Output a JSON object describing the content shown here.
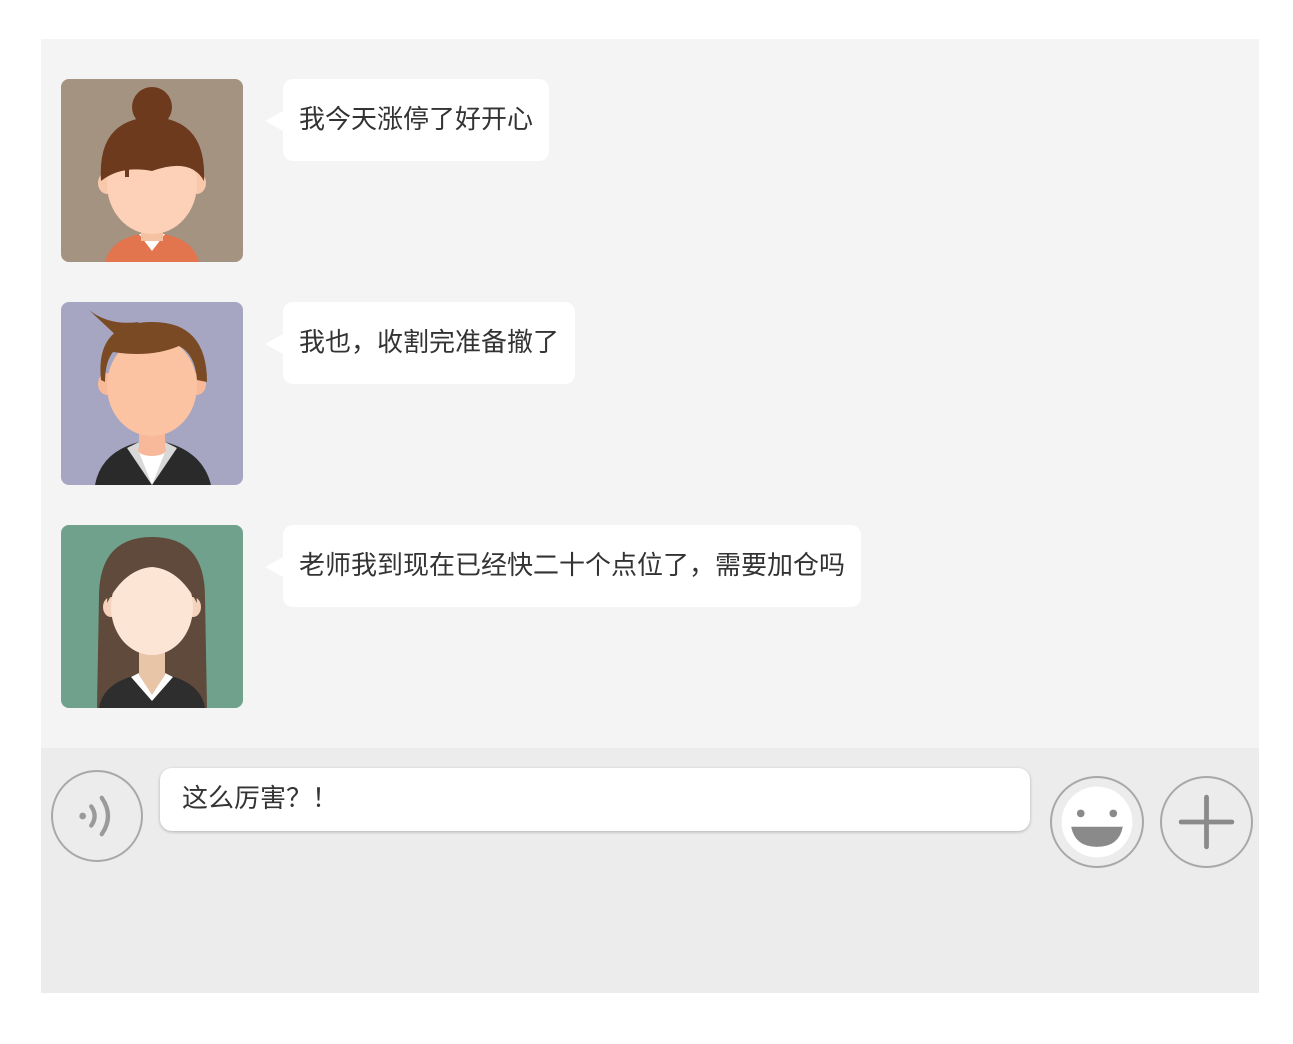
{
  "messages": [
    {
      "text": "我今天涨停了好开心",
      "avatar_icon": "woman-bun-avatar-icon"
    },
    {
      "text": "我也，收割完准备撤了",
      "avatar_icon": "man-suit-avatar-icon"
    },
    {
      "text": "老师我到现在已经快二十个点位了，需要加仓吗",
      "avatar_icon": "woman-long-hair-avatar-icon"
    }
  ],
  "input_bar": {
    "value": "这么厉害？！",
    "voice_icon": "voice-icon",
    "emoji_icon": "emoji-icon",
    "plus_icon": "plus-icon"
  },
  "colors": {
    "chat_background": "#f4f4f4",
    "input_bar_background": "#ececec",
    "bubble": "#ffffff",
    "text": "#333333",
    "icon_stroke": "#a8a8a8"
  }
}
